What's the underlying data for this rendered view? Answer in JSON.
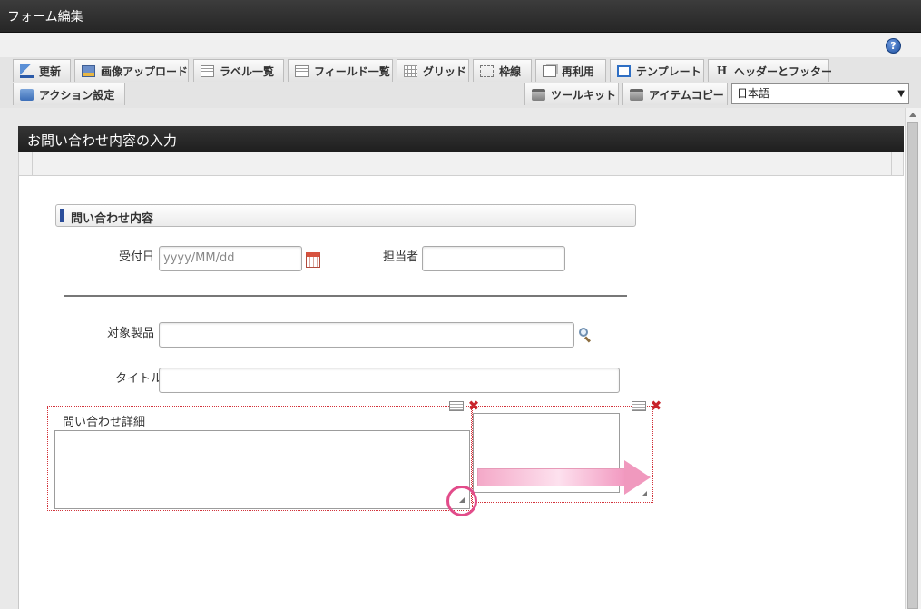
{
  "window": {
    "title": "フォーム編集"
  },
  "toolbar": {
    "tabs_row1": [
      {
        "label": "更新",
        "icon": "update-icon"
      },
      {
        "label": "画像アップロード",
        "icon": "image-upload-icon"
      },
      {
        "label": "ラベル一覧",
        "icon": "label-list-icon"
      },
      {
        "label": "フィールド一覧",
        "icon": "field-list-icon"
      },
      {
        "label": "グリッド",
        "icon": "grid-icon"
      },
      {
        "label": "枠線",
        "icon": "border-icon"
      },
      {
        "label": "再利用",
        "icon": "reuse-icon"
      },
      {
        "label": "テンプレート",
        "icon": "template-icon"
      },
      {
        "label": "ヘッダーとフッター",
        "icon": "header-footer-icon"
      }
    ],
    "tabs_row2": [
      {
        "label": "アクション設定",
        "icon": "action-settings-icon"
      },
      {
        "label": "ツールキット",
        "icon": "toolkit-icon"
      },
      {
        "label": "アイテムコピー",
        "icon": "item-copy-icon"
      }
    ],
    "language": {
      "selected": "日本語"
    },
    "help_icon": "?"
  },
  "form": {
    "header_title": "お問い合わせ内容の入力",
    "section_title": "問い合わせ内容",
    "fields": {
      "received_date": {
        "label": "受付日",
        "placeholder": "yyyy/MM/dd"
      },
      "assignee": {
        "label": "担当者",
        "value": ""
      },
      "product": {
        "label": "対象製品",
        "value": ""
      },
      "title": {
        "label": "タイトル",
        "value": ""
      },
      "details": {
        "label": "問い合わせ詳細",
        "value": ""
      }
    }
  },
  "colors": {
    "accent_pink": "#e24c8a",
    "delete_red": "#c8252c",
    "section_bar": "#2b4d9a"
  }
}
